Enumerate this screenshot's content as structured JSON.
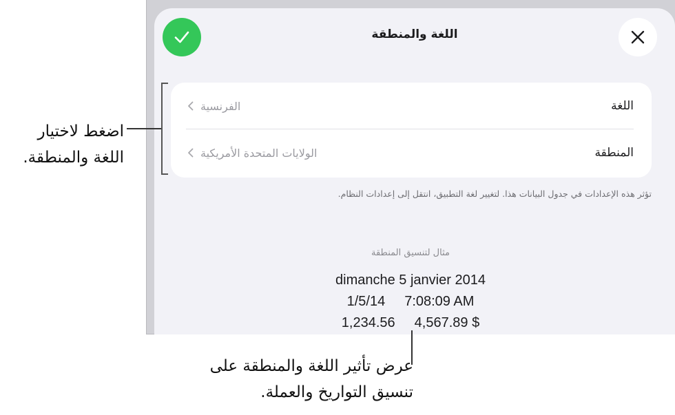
{
  "dialog": {
    "title": "اللغة والمنطقة",
    "done_icon": "checkmark-icon",
    "close_icon": "close-icon"
  },
  "settings": {
    "rows": [
      {
        "label": "اللغة",
        "value": "الفرنسية"
      },
      {
        "label": "المنطقة",
        "value": "الولايات المتحدة الأمريكية"
      }
    ],
    "footnote": "تؤثر هذه الإعدادات في جدول البيانات هذا. لتغيير لغة التطبيق، انتقل إلى إعدادات النظام."
  },
  "example": {
    "title": "مثال لتنسيق المنطقة",
    "date": "dimanche 5 janvier 2014",
    "short_date": "1/5/14",
    "time": "7:08:09 AM",
    "number": "1,234.56",
    "currency": "4,567.89 $"
  },
  "annotations": {
    "language_region": "اضغط لاختيار اللغة والمنطقة.",
    "format_effect": "عرض تأثير اللغة والمنطقة على تنسيق التواريخ والعملة."
  },
  "colors": {
    "accent_green": "#34c759",
    "sheet_background": "#f2f2f7",
    "device_background": "#d1d1d6"
  }
}
